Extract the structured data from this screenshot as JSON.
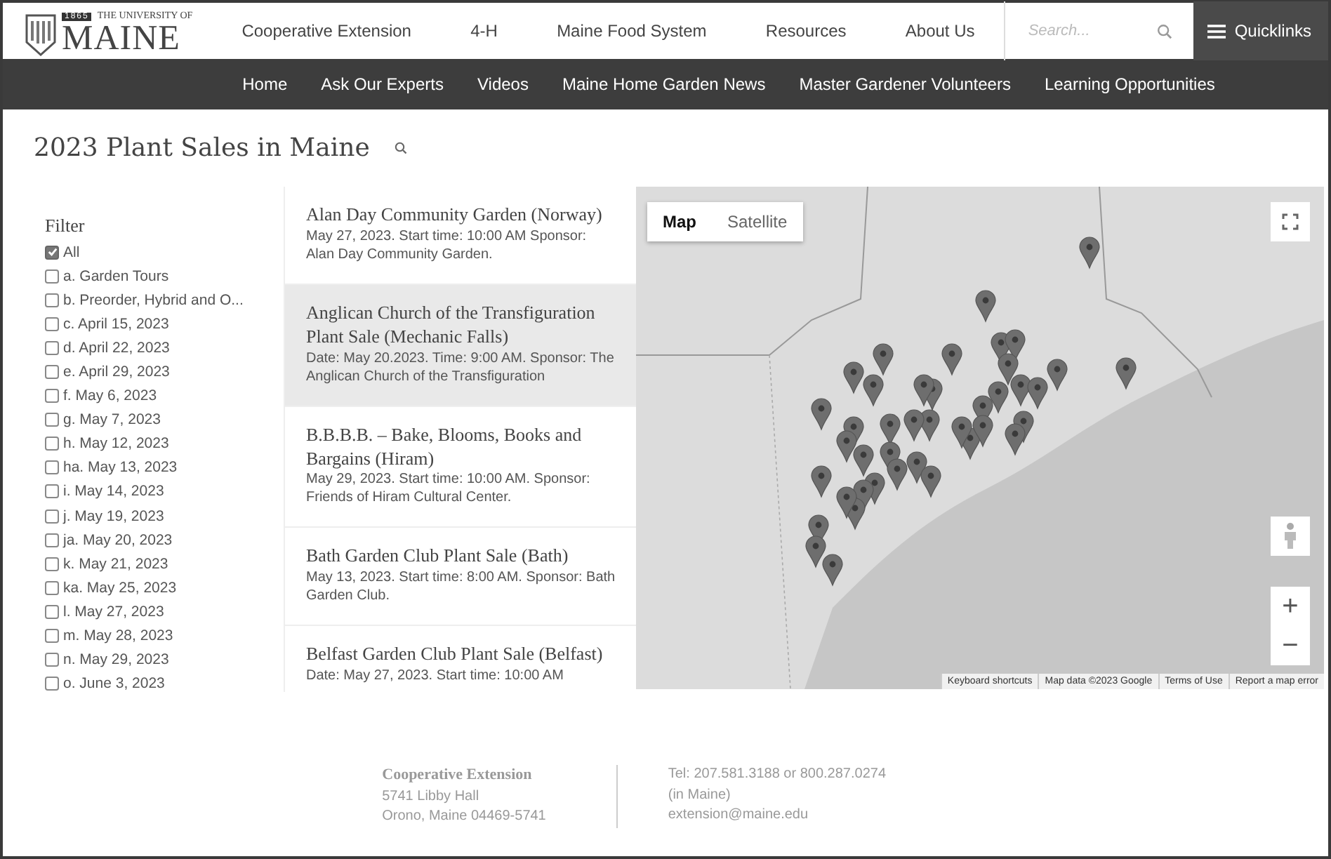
{
  "header": {
    "logo": {
      "year": "1865",
      "top": "THE UNIVERSITY OF",
      "name": "MAINE"
    },
    "nav": [
      "Cooperative Extension",
      "4-H",
      "Maine Food System",
      "Resources",
      "About Us"
    ],
    "search": {
      "placeholder": "Search..."
    },
    "quicklinks": "Quicklinks"
  },
  "subnav": [
    "Home",
    "Ask Our Experts",
    "Videos",
    "Maine Home Garden News",
    "Master Gardener Volunteers",
    "Learning Opportunities"
  ],
  "page_title": "2023 Plant Sales in Maine",
  "filter": {
    "title": "Filter",
    "items": [
      {
        "label": "All",
        "checked": true
      },
      {
        "label": "a. Garden Tours",
        "checked": false
      },
      {
        "label": "b. Preorder, Hybrid and O...",
        "checked": false
      },
      {
        "label": "c. April 15, 2023",
        "checked": false
      },
      {
        "label": "d. April 22, 2023",
        "checked": false
      },
      {
        "label": "e. April 29, 2023",
        "checked": false
      },
      {
        "label": "f. May 6, 2023",
        "checked": false
      },
      {
        "label": "g. May 7, 2023",
        "checked": false
      },
      {
        "label": "h. May 12, 2023",
        "checked": false
      },
      {
        "label": "ha. May 13, 2023",
        "checked": false
      },
      {
        "label": "i. May 14, 2023",
        "checked": false
      },
      {
        "label": "j. May 19, 2023",
        "checked": false
      },
      {
        "label": "ja. May 20, 2023",
        "checked": false
      },
      {
        "label": "k. May 21, 2023",
        "checked": false
      },
      {
        "label": "ka. May 25, 2023",
        "checked": false
      },
      {
        "label": "l. May 27, 2023",
        "checked": false
      },
      {
        "label": "m. May 28, 2023",
        "checked": false
      },
      {
        "label": "n. May 29, 2023",
        "checked": false
      },
      {
        "label": "o. June 3, 2023",
        "checked": false
      }
    ]
  },
  "sales": [
    {
      "title": "Alan Day Community Garden (Norway)",
      "details": "May 27, 2023. Start time: 10:00 AM Sponsor: Alan Day Community Garden.",
      "selected": false
    },
    {
      "title": "Anglican Church of the Transfiguration Plant Sale (Mechanic Falls)",
      "details": "Date: May 20.2023. Time: 9:00 AM. Sponsor: The Anglican Church of the Transfiguration",
      "selected": true
    },
    {
      "title": "B.B.B.B. – Bake, Blooms, Books and Bargains (Hiram)",
      "details": "May 29, 2023. Start time: 10:00 AM. Sponsor: Friends of Hiram Cultural Center.",
      "selected": false
    },
    {
      "title": "Bath Garden Club Plant Sale (Bath)",
      "details": "May 13, 2023. Start time: 8:00 AM. Sponsor: Bath Garden Club.",
      "selected": false
    },
    {
      "title": "Belfast Garden Club Plant Sale (Belfast)",
      "details": "Date: May 27, 2023. Start time: 10:00 AM",
      "selected": false
    }
  ],
  "map": {
    "tabs": [
      {
        "label": "Map",
        "selected": true
      },
      {
        "label": "Satellite",
        "selected": false
      }
    ],
    "zoom": [
      "+",
      "−"
    ],
    "attribution": [
      "Keyboard shortcuts",
      "Map data ©2023 Google",
      "Terms of Use",
      "Report a map error"
    ]
  },
  "footer": {
    "org": "Cooperative Extension",
    "address": [
      "5741 Libby Hall",
      "Orono, Maine 04469-5741"
    ],
    "contact": [
      "Tel: 207.581.3188 or 800.287.0274",
      "(in Maine)",
      "extension@maine.edu"
    ]
  }
}
